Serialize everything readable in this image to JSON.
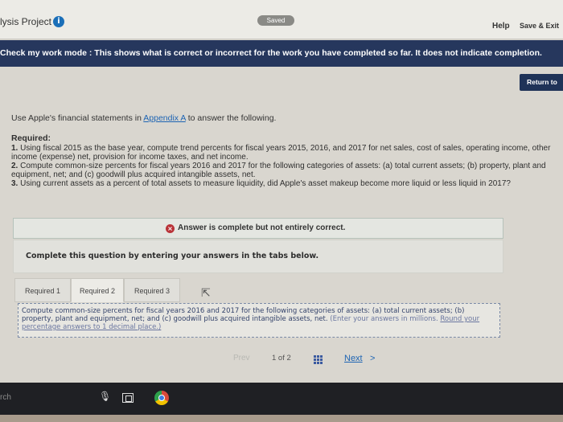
{
  "header": {
    "app_title": "lysis Project",
    "info_icon": "info-icon",
    "saved_label": "Saved",
    "help_label": "Help",
    "save_exit_label": "Save & Exit"
  },
  "banner": {
    "text": "Check my work mode : This shows what is correct or incorrect for the work you have completed so far. It does not indicate completion."
  },
  "return_button": {
    "label": "Return to"
  },
  "instructions": {
    "pre": "Use Apple's financial statements in ",
    "link": "Appendix A",
    "post": " to answer the following."
  },
  "required": {
    "title": "Required:",
    "items": [
      {
        "num": "1.",
        "text": " Using fiscal 2015 as the base year, compute trend percents for fiscal years 2015, 2016, and 2017 for net sales, cost of sales, operating income, other income (expense) net, provision for income taxes, and net income."
      },
      {
        "num": "2.",
        "text": " Compute common-size percents for fiscal years 2016 and 2017 for the following categories of assets: (a) total current assets; (b) property, plant and equipment, net; and (c) goodwill plus acquired intangible assets, net."
      },
      {
        "num": "3.",
        "text": " Using current assets as a percent of total assets to measure liquidity, did Apple's asset makeup become more liquid or less liquid in 2017?"
      }
    ]
  },
  "answer_status": {
    "text": "Answer is complete but not entirely correct.",
    "icon": "x-circle-icon",
    "icon_color": "#b93338"
  },
  "complete_prompt": {
    "text": "Complete this question by entering your answers in the tabs below."
  },
  "tabs": [
    {
      "label": "Required 1",
      "active": false
    },
    {
      "label": "Required 2",
      "active": true
    },
    {
      "label": "Required 3",
      "active": false
    }
  ],
  "question": {
    "text": "Compute common-size percents for fiscal years 2016 and 2017 for the following categories of assets: (a) total current assets; (b) property, plant and equipment, net; and (c) goodwill plus acquired intangible assets, net.",
    "hint": "(Enter your answers in millions.",
    "round": "Round your percentage answers to 1 decimal place.)"
  },
  "pager": {
    "prev_label": "Prev",
    "page_text": "1 of 2",
    "next_label": "Next",
    "next_icon": ">"
  },
  "taskbar": {
    "search_text": "rch"
  },
  "colors": {
    "banner": "#26375d",
    "return_button": "#1f3358",
    "link": "#1d64b3",
    "error": "#b93338"
  }
}
